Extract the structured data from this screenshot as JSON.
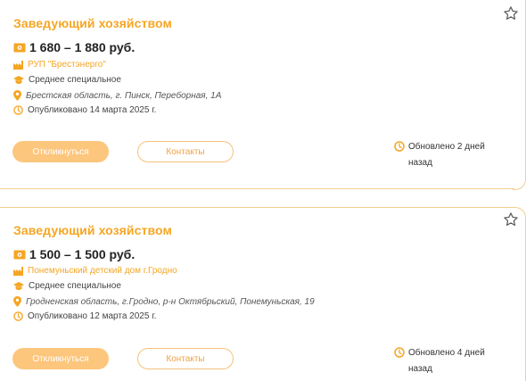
{
  "vacancies": [
    {
      "title": "Заведующий хозяйством",
      "salary": "1 680 – 1 880 руб.",
      "company": "РУП \"Брестэнерго\"",
      "education": "Среднее специальное",
      "address": "Брестская область, г. Пинск, Переборная, 1А",
      "published": "Опубликовано 14 марта 2025 г.",
      "apply_label": "Откликнуться",
      "contacts_label": "Контакты",
      "updated_line1": "Обновлено 2 дней",
      "updated_line2": "назад"
    },
    {
      "title": "Заведующий хозяйством",
      "salary": "1 500 – 1 500 руб.",
      "company": "Понемуньский детский дом г.Гродно",
      "education": "Среднее специальное",
      "address": "Гродненская область, г.Гродно, р-н Октябрьский, Понемуньская, 19",
      "published": "Опубликовано 12 марта 2025 г.",
      "apply_label": "Откликнуться",
      "contacts_label": "Контакты",
      "updated_line1": "Обновлено 4 дней",
      "updated_line2": "назад"
    }
  ],
  "colors": {
    "accent": "#f5a623",
    "button_fill": "#fcc67d",
    "border": "#f3d08f"
  },
  "icons": {
    "salary": "money-icon",
    "company": "factory-icon",
    "education": "graduation-cap-icon",
    "address": "location-pin-icon",
    "published": "clock-icon",
    "updated": "clock-icon",
    "favorite": "star-icon"
  }
}
